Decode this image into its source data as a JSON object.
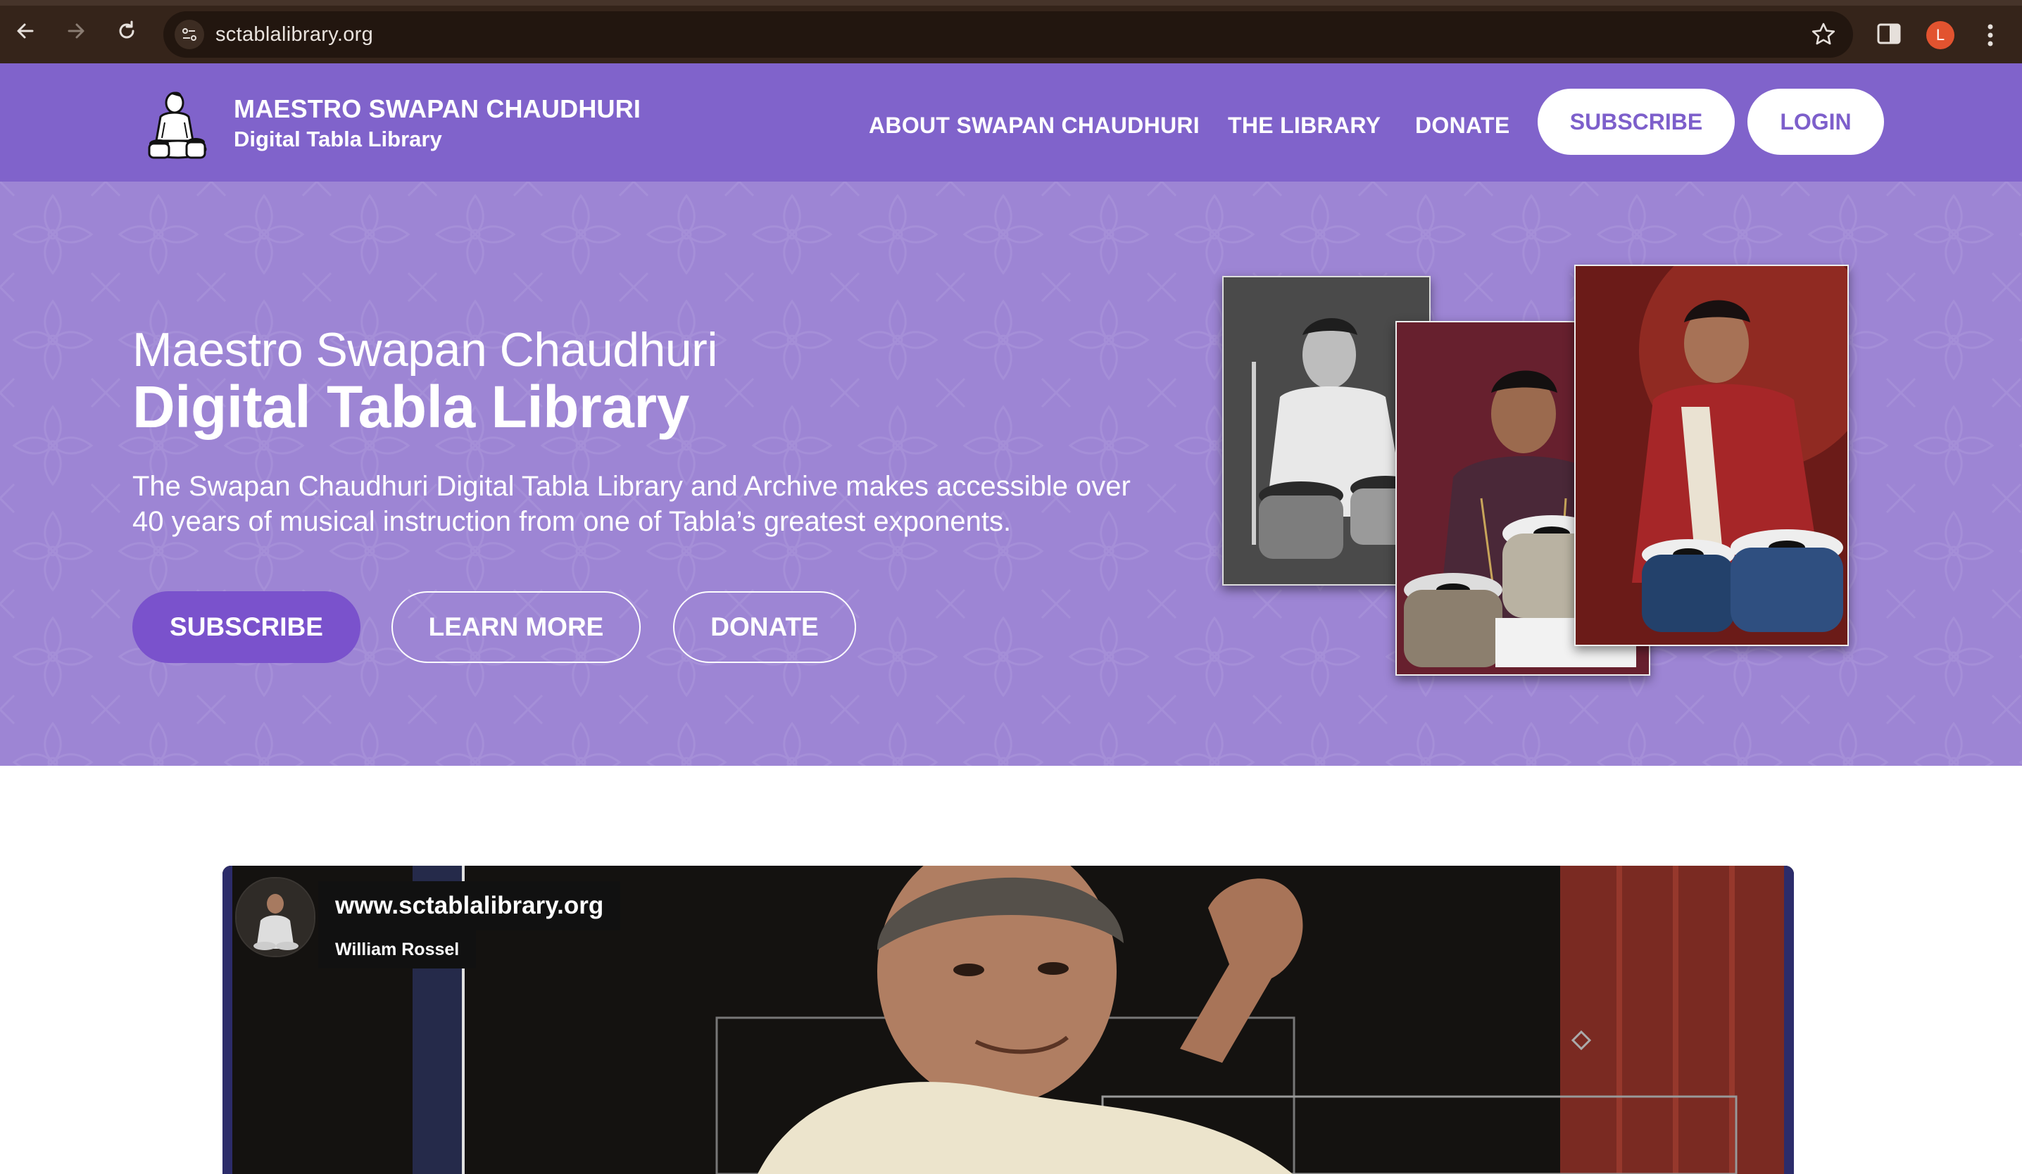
{
  "browser": {
    "url": "sctablalibrary.org",
    "profile_initial": "L",
    "icons": [
      "back-arrow-icon",
      "forward-arrow-icon",
      "reload-icon",
      "site-settings-icon",
      "bookmark-star-icon",
      "side-panel-icon",
      "more-vert-icon"
    ]
  },
  "header": {
    "brand_title": "MAESTRO SWAPAN CHAUDHURI",
    "brand_subtitle": "Digital Tabla Library",
    "nav": {
      "about": "ABOUT SWAPAN CHAUDHURI",
      "library": "THE LIBRARY",
      "donate": "DONATE"
    },
    "subscribe": "SUBSCRIBE",
    "login": "LOGIN"
  },
  "hero": {
    "title_line1": "Maestro Swapan Chaudhuri",
    "title_line2": "Digital Tabla Library",
    "description": "The Swapan Chaudhuri Digital Tabla Library and Archive makes accessible over 40 years of musical instruction from one of Tabla’s greatest exponents.",
    "buttons": {
      "subscribe": "SUBSCRIBE",
      "learn_more": "LEARN MORE",
      "donate": "DONATE"
    }
  },
  "video": {
    "title": "www.sctablalibrary.org",
    "author": "William Rossel"
  },
  "colors": {
    "header_bg": "#8063cb",
    "hero_bg": "#9d85d4",
    "primary_button": "#7a52cc",
    "browser_chrome": "#35241a"
  }
}
